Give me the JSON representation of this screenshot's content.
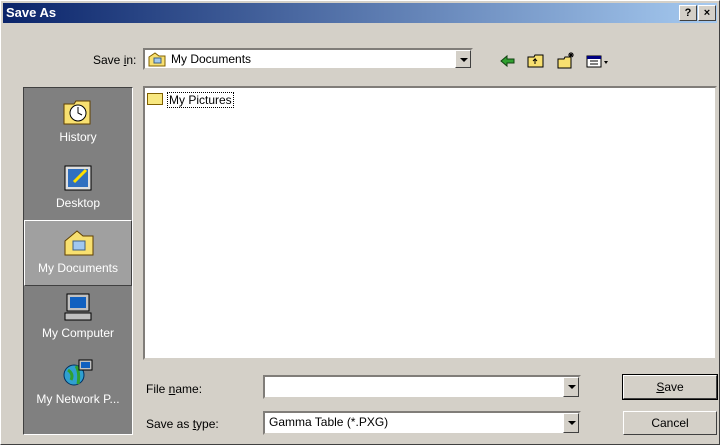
{
  "window": {
    "title": "Save As",
    "help_label": "?",
    "close_label": "×"
  },
  "toolbar": {
    "save_in_label_pre": "Save ",
    "save_in_label_key": "i",
    "save_in_label_post": "n:",
    "save_in_value": "My Documents"
  },
  "places": [
    {
      "label": "History"
    },
    {
      "label": "Desktop"
    },
    {
      "label": "My Documents"
    },
    {
      "label": "My Computer"
    },
    {
      "label": "My Network P..."
    }
  ],
  "files": [
    {
      "name": "My Pictures"
    }
  ],
  "filename": {
    "label_pre": "File ",
    "label_key": "n",
    "label_post": "ame:",
    "value": ""
  },
  "filetype": {
    "label_pre": "Save as ",
    "label_key": "t",
    "label_post": "ype:",
    "value": "Gamma Table (*.PXG)"
  },
  "buttons": {
    "save_key": "S",
    "save_rest": "ave",
    "cancel": "Cancel"
  }
}
